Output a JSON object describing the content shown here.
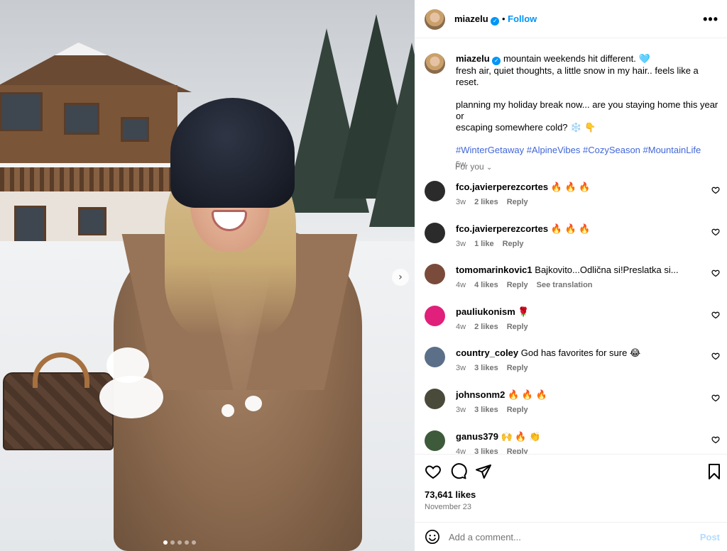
{
  "post": {
    "author": "miazelu",
    "follow_label": "Follow",
    "more_label": "•••",
    "caption_lines": [
      "mountain weekends hit different. 🩵",
      "fresh air, quiet thoughts, a little snow in my hair.. feels like a reset.",
      "planning my holiday break now... are you staying home this year or",
      "escaping somewhere cold? ❄️ 👇"
    ],
    "hashtags": "#WinterGetaway #AlpineVibes #CozySeason #MountainLife",
    "age": "5w",
    "for_you": "For you",
    "likes": "73,641 likes",
    "date": "November 23",
    "add_comment_placeholder": "Add a comment...",
    "post_label": "Post",
    "next_arrow": "›"
  },
  "comments": [
    {
      "user": "fco.javierperezcortes",
      "text": "🔥 🔥 🔥",
      "age": "3w",
      "likes": "2 likes",
      "reply": "Reply",
      "extra": "",
      "avatar_color": "#2b2b2b"
    },
    {
      "user": "fco.javierperezcortes",
      "text": "🔥 🔥 🔥",
      "age": "3w",
      "likes": "1 like",
      "reply": "Reply",
      "extra": "",
      "avatar_color": "#2b2b2b"
    },
    {
      "user": "tomomarinkovic1",
      "text": "Bajkovito...Odlična si!Preslatka si...",
      "age": "4w",
      "likes": "4 likes",
      "reply": "Reply",
      "extra": "See translation",
      "avatar_color": "#7a4b3a"
    },
    {
      "user": "pauliukonism",
      "text": "🌹",
      "age": "4w",
      "likes": "2 likes",
      "reply": "Reply",
      "extra": "",
      "avatar_color": "#e0207a"
    },
    {
      "user": "country_coley",
      "text": "God has favorites for sure 😂",
      "age": "3w",
      "likes": "3 likes",
      "reply": "Reply",
      "extra": "",
      "avatar_color": "#5b6f88"
    },
    {
      "user": "johnsonm2",
      "text": "🔥 🔥 🔥",
      "age": "3w",
      "likes": "3 likes",
      "reply": "Reply",
      "extra": "",
      "avatar_color": "#4a4a3a"
    },
    {
      "user": "ganus379",
      "text": "🙌 🔥 👏",
      "age": "4w",
      "likes": "3 likes",
      "reply": "Reply",
      "extra": "",
      "avatar_color": "#3d5a3a"
    }
  ],
  "icons": {
    "heart": "heart-icon",
    "comment": "comment-icon",
    "share": "share-icon",
    "save": "bookmark-icon",
    "emoji": "smile-icon"
  },
  "colors": {
    "accent": "#0095f6",
    "hashtag": "#4267d8",
    "muted": "#737373"
  }
}
